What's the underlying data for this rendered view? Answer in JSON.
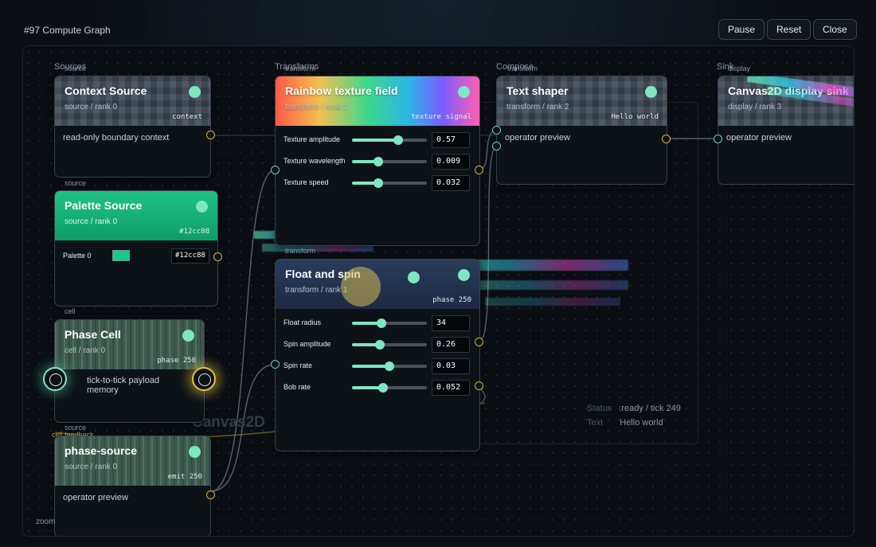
{
  "header": {
    "title": "#97 Compute Graph",
    "pause_label": "Pause",
    "reset_label": "Reset",
    "close_label": "Close"
  },
  "lanes": {
    "sources": "Sources",
    "transforms": "Transforms",
    "compose": "Compose",
    "sink": "Sink"
  },
  "nodes": {
    "context_source": {
      "tag": "source",
      "title": "Context Source",
      "subtitle": "source / rank 0",
      "badge": "context",
      "body": "read-only boundary context"
    },
    "palette_source": {
      "tag": "source",
      "title": "Palette Source",
      "subtitle": "source / rank 0",
      "badge": "#12cc88",
      "field_label": "Palette 0",
      "field_value": "#12cc88"
    },
    "phase_cell": {
      "tag": "cell",
      "title": "Phase Cell",
      "subtitle": "cell / rank 0",
      "badge": "phase 250",
      "body": "tick-to-tick payload memory"
    },
    "phase_source": {
      "tag": "source",
      "tag2": "cell feedback",
      "title": "phase-source",
      "subtitle": "source / rank 0",
      "badge": "emit 250",
      "body": "operator preview"
    },
    "rainbow_texture": {
      "tag": "transform",
      "title": "Rainbow texture field",
      "subtitle": "transform / rank 1",
      "badge": "texture signal",
      "params": [
        {
          "label": "Texture amplitude",
          "value": "0.57",
          "level": 0.62
        },
        {
          "label": "Texture wavelength",
          "value": "0.009",
          "level": 0.35
        },
        {
          "label": "Texture speed",
          "value": "0.032",
          "level": 0.35
        }
      ]
    },
    "float_spin": {
      "tag": "transform",
      "title": "Float and spin",
      "subtitle": "transform / rank 1",
      "badge": "phase 250",
      "params": [
        {
          "label": "Float radius",
          "value": "34",
          "level": 0.39
        },
        {
          "label": "Spin amplitude",
          "value": "0.26",
          "level": 0.37
        },
        {
          "label": "Spin rate",
          "value": "0.03",
          "level": 0.5
        },
        {
          "label": "Bob rate",
          "value": "0.052",
          "level": 0.42
        }
      ]
    },
    "text_shaper": {
      "tag": "transform",
      "title": "Text shaper",
      "subtitle": "transform / rank 2",
      "badge": "Hello world",
      "body": "operator preview"
    },
    "display_sink": {
      "tag": "display",
      "title": "Canvas2D display sink",
      "subtitle": "display / rank 3",
      "body": "operator preview"
    }
  },
  "status": {
    "status_label": "Status",
    "status_value": ":ready / tick 249",
    "text_label": "Text",
    "text_value": "Hello world"
  },
  "canvas_label": "Canvas2D",
  "zoom_label": "zoom",
  "colors": {
    "accent": "#7ee7c2",
    "port_out": "#d8b43a",
    "palette": "#12cc88"
  }
}
